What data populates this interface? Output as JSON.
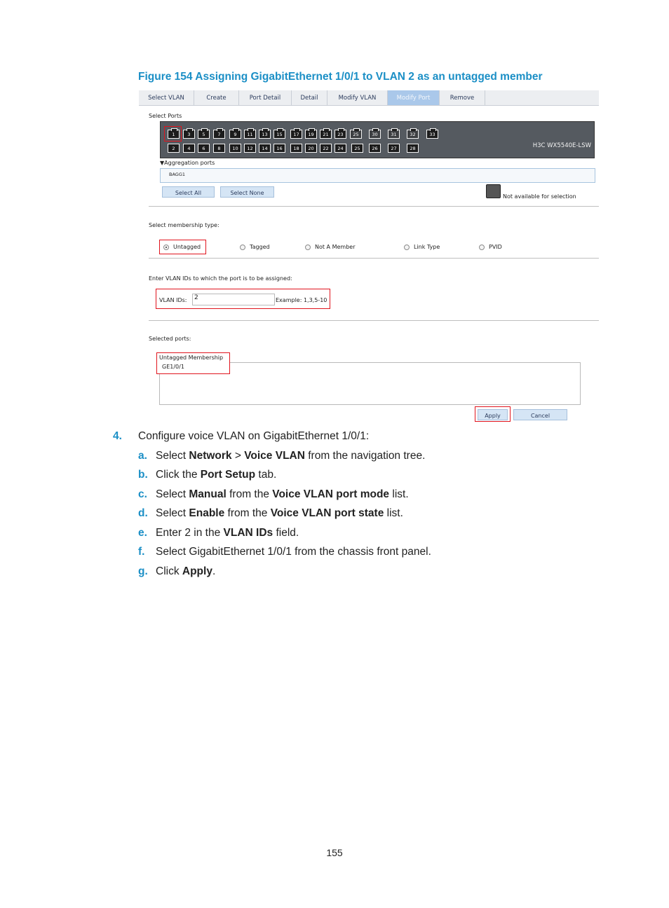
{
  "caption": "Figure 154 Assigning GigabitEthernet 1/0/1 to VLAN 2 as an untagged member",
  "tabs": [
    {
      "label": "Select VLAN"
    },
    {
      "label": "Create"
    },
    {
      "label": "Port Detail"
    },
    {
      "label": "Detail"
    },
    {
      "label": "Modify VLAN"
    },
    {
      "label": "Modify Port"
    },
    {
      "label": "Remove"
    }
  ],
  "select_ports_label": "Select Ports",
  "ports_top": [
    "1",
    "3",
    "5",
    "7",
    "9",
    "11",
    "13",
    "15",
    "17",
    "19",
    "21",
    "23",
    "25",
    "30",
    "31",
    "32",
    "33"
  ],
  "ports_bottom": [
    "2",
    "4",
    "6",
    "8",
    "10",
    "12",
    "14",
    "16",
    "18",
    "20",
    "22",
    "24",
    "25",
    "26",
    "27",
    "28"
  ],
  "device_model": "H3C WX5540E-LSW",
  "aggregation_label": "▼Aggregation ports",
  "aggregation_item": "BAGG1",
  "select_all_label": "Select All",
  "select_none_label": "Select None",
  "not_available_label": "Not available for selection",
  "membership_label": "Select membership type:",
  "membership_options": [
    {
      "label": "Untagged",
      "selected": true
    },
    {
      "label": "Tagged",
      "selected": false
    },
    {
      "label": "Not A Member",
      "selected": false
    },
    {
      "label": "Link Type",
      "selected": false
    },
    {
      "label": "PVID",
      "selected": false
    }
  ],
  "vlan_section_label": "Enter VLAN IDs to which the port is to be assigned:",
  "vlan_ids_label": "VLAN IDs:",
  "vlan_ids_value": "2",
  "vlan_example": "Example: 1,3,5-10",
  "selected_ports_label": "Selected ports:",
  "untagged_membership_label": "Untagged Membership",
  "untagged_port": "GE1/0/1",
  "apply_label": "Apply",
  "cancel_label": "Cancel",
  "step4": {
    "num": "4.",
    "text": "Configure voice VLAN on GigabitEthernet 1/0/1:"
  },
  "substeps": {
    "a": {
      "num": "a.",
      "t1": "Select ",
      "b1": "Network",
      "t2": " > ",
      "b2": "Voice VLAN",
      "t3": " from the navigation tree."
    },
    "b": {
      "num": "b.",
      "t1": "Click the ",
      "b1": "Port Setup",
      "t2": " tab."
    },
    "c": {
      "num": "c.",
      "t1": "Select ",
      "b1": "Manual",
      "t2": " from the ",
      "b2": "Voice VLAN port mode",
      "t3": " list."
    },
    "d": {
      "num": "d.",
      "t1": "Select ",
      "b1": "Enable",
      "t2": " from the ",
      "b2": "Voice VLAN port state",
      "t3": " list."
    },
    "e": {
      "num": "e.",
      "t1": "Enter 2 in the ",
      "b1": "VLAN IDs",
      "t2": " field."
    },
    "f": {
      "num": "f.",
      "t1": "Select GigabitEthernet 1/0/1 from the chassis front panel."
    },
    "g": {
      "num": "g.",
      "t1": "Click ",
      "b1": "Apply",
      "t2": "."
    }
  },
  "page_number": "155"
}
